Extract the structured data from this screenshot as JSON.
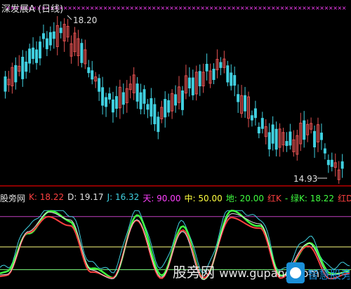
{
  "price_pane": {
    "title": "深发展A (日线)",
    "high_label": "18.20",
    "low_label": "14.93",
    "colors": {
      "up": "#e05050",
      "down": "#40d0e0",
      "marker": "#ff40ff",
      "title": "#e0e0e0"
    }
  },
  "kdj_pane": {
    "legend": [
      {
        "text": "股旁网",
        "color": "#e0e0e0"
      },
      {
        "text": "K: 18.22",
        "color": "#ff4040"
      },
      {
        "text": "D: 19.17",
        "color": "#e0e0e0"
      },
      {
        "text": "J: 16.32",
        "color": "#40d0e0"
      },
      {
        "text": "天: 90.00",
        "color": "#ff40ff"
      },
      {
        "text": "中: 50.00",
        "color": "#ffff40"
      },
      {
        "text": "地: 20.00",
        "color": "#40ff40"
      },
      {
        "text": "红K",
        "color": "#ff4040"
      },
      {
        "text": "- 绿K: 18.22",
        "color": "#40ff40"
      },
      {
        "text": "红D: -",
        "color": "#ff4040"
      }
    ],
    "levels": [
      {
        "name": "天",
        "value": 90,
        "color": "#c040c0"
      },
      {
        "name": "中",
        "value": 50,
        "color": "#ffff80"
      },
      {
        "name": "地",
        "value": 20,
        "color": "#80ff80"
      }
    ]
  },
  "watermark": {
    "text": "股旁网",
    "url": "www.gupang.com",
    "logo_text": "智慧股旁网"
  }
}
